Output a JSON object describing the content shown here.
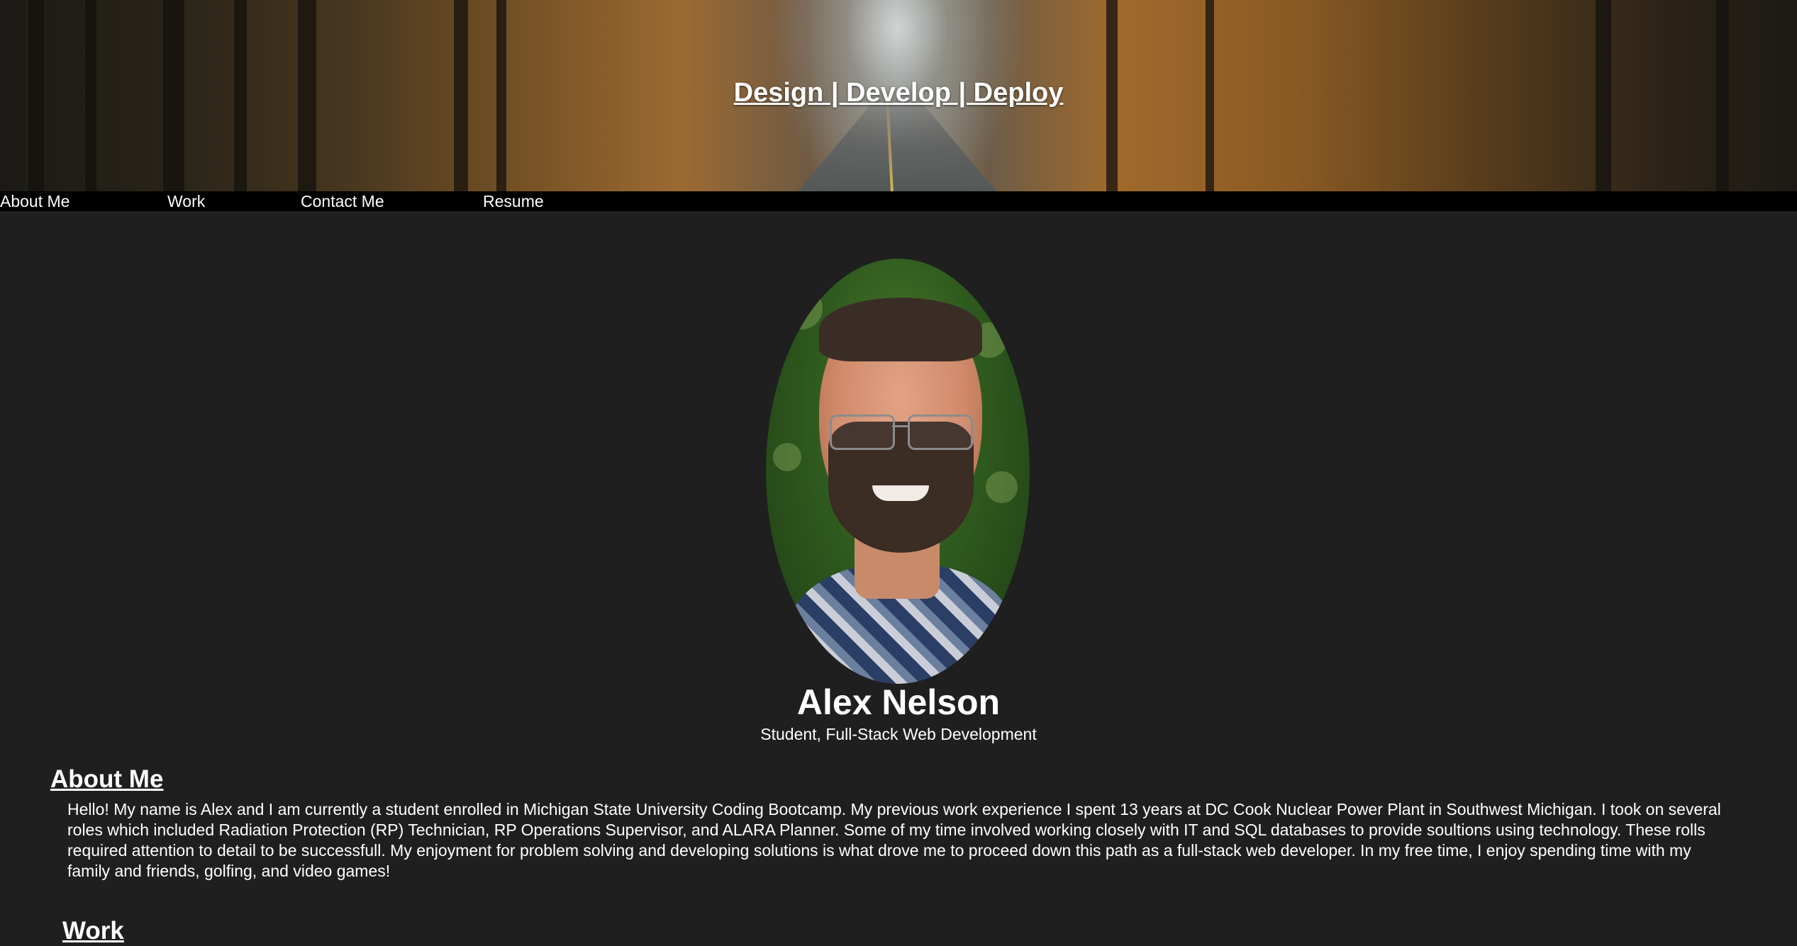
{
  "hero": {
    "title": "Design | Develop | Deploy"
  },
  "nav": {
    "items": [
      {
        "label": "About Me"
      },
      {
        "label": "Work"
      },
      {
        "label": "Contact Me"
      },
      {
        "label": "Resume"
      }
    ]
  },
  "profile": {
    "name": "Alex Nelson",
    "subtitle": "Student, Full-Stack Web Development"
  },
  "about": {
    "heading": "About Me",
    "text": "Hello! My name is Alex and I am currently a student enrolled in Michigan State University Coding Bootcamp. My previous work experience I spent 13 years at DC Cook Nuclear Power Plant in Southwest Michigan. I took on several roles which included Radiation Protection (RP) Technician, RP Operations Supervisor, and ALARA Planner. Some of my time involved working closely with IT and SQL databases to provide soultions using technology. These rolls required attention to detail to be successfull. My enjoyment for problem solving and developing solutions is what drove me to proceed down this path as a full-stack web developer. In my free time, I enjoy spending time with my family and friends, golfing, and video games!"
  },
  "work": {
    "heading": "Work"
  }
}
